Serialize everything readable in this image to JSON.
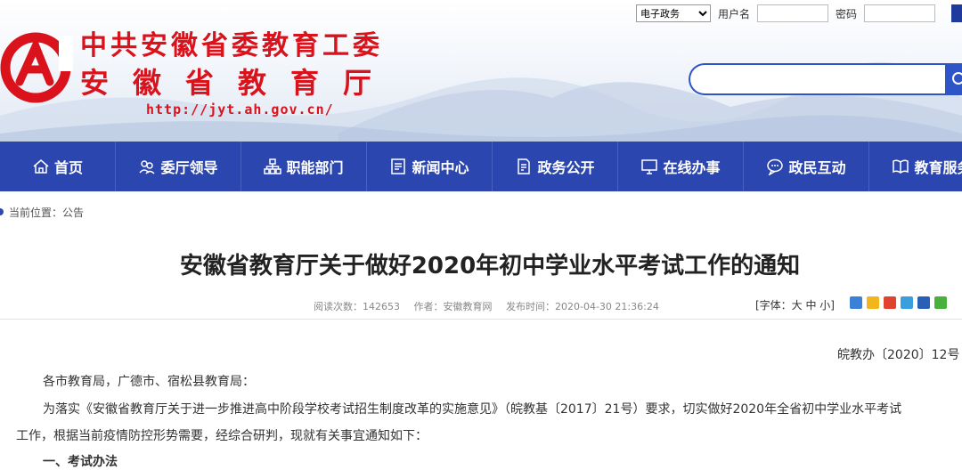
{
  "site": {
    "name_line1": "中共安徽省委教育工委",
    "name_line2": "安徽省教育厅",
    "url": "http://jyt.ah.gov.cn/",
    "brand_color": "#d9121b",
    "nav_color": "#2c46b0"
  },
  "topbar": {
    "service_select": "电子政务",
    "username_label": "用户名",
    "password_label": "密码"
  },
  "search": {
    "placeholder": ""
  },
  "nav": {
    "items": [
      {
        "label": "首页",
        "icon": "home-icon"
      },
      {
        "label": "委厅领导",
        "icon": "leaders-icon"
      },
      {
        "label": "职能部门",
        "icon": "org-chart-icon"
      },
      {
        "label": "新闻中心",
        "icon": "news-icon"
      },
      {
        "label": "政务公开",
        "icon": "document-icon"
      },
      {
        "label": "在线办事",
        "icon": "monitor-icon"
      },
      {
        "label": "政民互动",
        "icon": "chat-icon"
      },
      {
        "label": "教育服务",
        "icon": "book-icon"
      }
    ]
  },
  "breadcrumb": {
    "label": "当前位置：",
    "current": "公告"
  },
  "article": {
    "title": "安徽省教育厅关于做好2020年初中学业水平考试工作的通知",
    "views": "阅读次数：142653",
    "author": "作者：安徽教育网",
    "published": "发布时间：2020-04-30 21:36:24",
    "font_size_label": "[字体：大 中 小]",
    "share_icons": [
      "plus-share-icon",
      "qzone-icon",
      "weibo-icon",
      "tencent-weibo-icon",
      "renren-icon",
      "wechat-icon"
    ],
    "doc_number": "皖教办〔2020〕12号",
    "salutation": "各市教育局，广德市、宿松县教育局：",
    "body_line1": "为落实《安徽省教育厅关于进一步推进高中阶段学校考试招生制度改革的实施意见》（皖教基〔2017〕21号）要求，切实做好2020年全省初中学业水平考试",
    "body_line2": "工作，根据当前疫情防控形势需要，经综合研判，现就有关事宜通知如下：",
    "section1": "一、考试办法"
  }
}
